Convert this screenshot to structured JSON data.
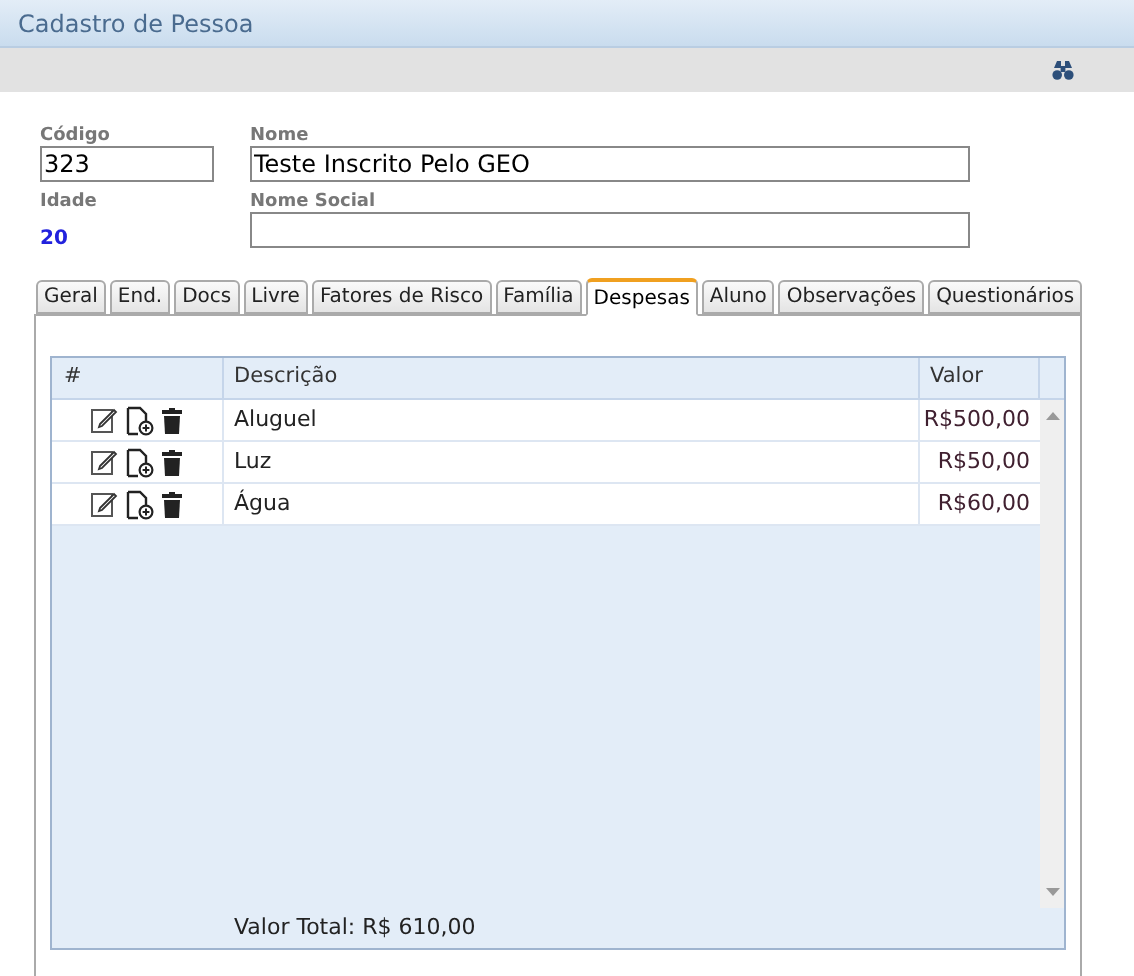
{
  "window": {
    "title": "Cadastro de Pessoa"
  },
  "fields": {
    "codigo": {
      "label": "Código",
      "value": "323"
    },
    "nome": {
      "label": "Nome",
      "value": "Teste Inscrito Pelo GEO"
    },
    "idade": {
      "label": "Idade",
      "value": "20"
    },
    "nome_social": {
      "label": "Nome Social"
    }
  },
  "tabs": [
    {
      "label": "Geral",
      "selected": false
    },
    {
      "label": "End.",
      "selected": false
    },
    {
      "label": "Docs",
      "selected": false
    },
    {
      "label": "Livre",
      "selected": false
    },
    {
      "label": "Fatores de Risco",
      "selected": false
    },
    {
      "label": "Família",
      "selected": false
    },
    {
      "label": "Despesas",
      "selected": true
    },
    {
      "label": "Aluno",
      "selected": false
    },
    {
      "label": "Observações",
      "selected": false
    },
    {
      "label": "Questionários",
      "selected": false
    }
  ],
  "table": {
    "columns": [
      "#",
      "Descrição",
      "Valor"
    ],
    "rows": [
      {
        "descricao": "Aluguel",
        "valor": "R$500,00"
      },
      {
        "descricao": "Luz",
        "valor": "R$50,00"
      },
      {
        "descricao": "Água",
        "valor": "R$60,00"
      }
    ],
    "total": "Valor Total: R$ 610,00"
  }
}
